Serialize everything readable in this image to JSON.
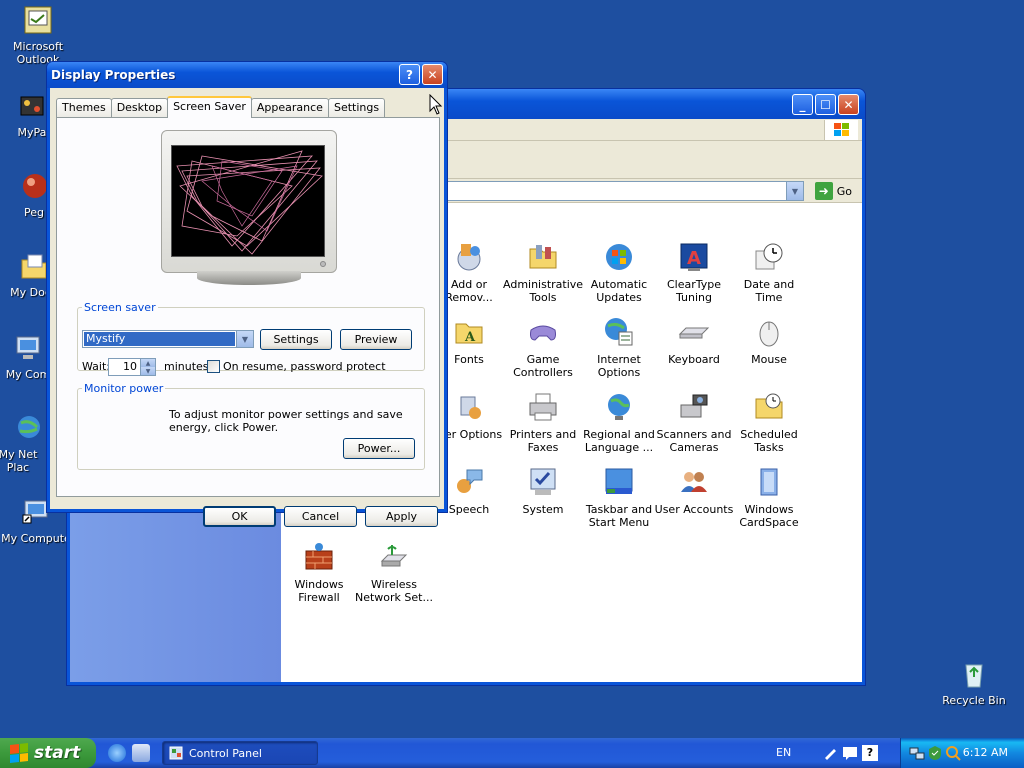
{
  "desktop_icons": [
    {
      "label": "Microsoft Outlook",
      "icon": "outlook-icon"
    },
    {
      "label": "MyPa",
      "icon": "myprograms-icon"
    },
    {
      "label": "Peg",
      "icon": "pegasus-icon"
    },
    {
      "label": "My Docu",
      "icon": "my-documents-icon"
    },
    {
      "label": "My Com",
      "icon": "my-computer-icon"
    },
    {
      "label": "My Net Plac",
      "icon": "network-places-icon"
    },
    {
      "label": "My Compute",
      "icon": "my-computer-shortcut-icon"
    },
    {
      "label": "Recycle Bin",
      "icon": "recycle-bin-icon"
    }
  ],
  "control_panel": {
    "go_label": "Go",
    "items": [
      {
        "label": "Add or Remov...",
        "icon": "add-remove-icon"
      },
      {
        "label": "Administrative Tools",
        "icon": "admin-tools-icon"
      },
      {
        "label": "Automatic Updates",
        "icon": "auto-updates-icon"
      },
      {
        "label": "ClearType Tuning",
        "icon": "cleartype-icon"
      },
      {
        "label": "Date and Time",
        "icon": "clock-icon"
      },
      {
        "label": "Fonts",
        "icon": "fonts-folder-icon"
      },
      {
        "label": "Game Controllers",
        "icon": "gamepad-icon"
      },
      {
        "label": "Internet Options",
        "icon": "internet-options-icon"
      },
      {
        "label": "Keyboard",
        "icon": "keyboard-icon"
      },
      {
        "label": "Mouse",
        "icon": "mouse-icon"
      },
      {
        "label": "wer Options",
        "icon": "power-options-icon"
      },
      {
        "label": "Printers and Faxes",
        "icon": "printer-icon"
      },
      {
        "label": "Regional and Language ...",
        "icon": "globe-icon"
      },
      {
        "label": "Scanners and Cameras",
        "icon": "scanner-icon"
      },
      {
        "label": "Scheduled Tasks",
        "icon": "scheduled-tasks-icon"
      },
      {
        "label": "Speech",
        "icon": "speech-icon"
      },
      {
        "label": "System",
        "icon": "system-icon"
      },
      {
        "label": "Taskbar and Start Menu",
        "icon": "taskbar-icon"
      },
      {
        "label": "User Accounts",
        "icon": "users-icon"
      },
      {
        "label": "Windows CardSpace",
        "icon": "cardspace-icon"
      },
      {
        "label": "Windows Firewall",
        "icon": "firewall-icon"
      },
      {
        "label": "Wireless Network Set...",
        "icon": "wireless-icon"
      }
    ]
  },
  "dialog": {
    "title": "Display Properties",
    "tabs": [
      "Themes",
      "Desktop",
      "Screen Saver",
      "Appearance",
      "Settings"
    ],
    "active_tab": "Screen Saver",
    "screen_saver": {
      "group_label": "Screen saver",
      "selected": "Mystify",
      "settings_label": "Settings",
      "preview_label": "Preview",
      "wait_label": "Wait:",
      "wait_value": "10",
      "minutes_label": "minutes",
      "password_label": "On resume, password protect",
      "password_checked": false
    },
    "monitor_power": {
      "group_label": "Monitor power",
      "text": "To adjust monitor power settings and save energy, click Power.",
      "power_label": "Power..."
    },
    "ok_label": "OK",
    "cancel_label": "Cancel",
    "apply_label": "Apply"
  },
  "taskbar": {
    "start_label": "start",
    "task_label": "Control Panel",
    "language": "EN",
    "clock": "6:12 AM"
  },
  "colors": {
    "desktop": "#1e4fa0",
    "titlebar": "#0a55d8",
    "group_label": "#0046d5",
    "start_green": "#3c9a3c"
  }
}
